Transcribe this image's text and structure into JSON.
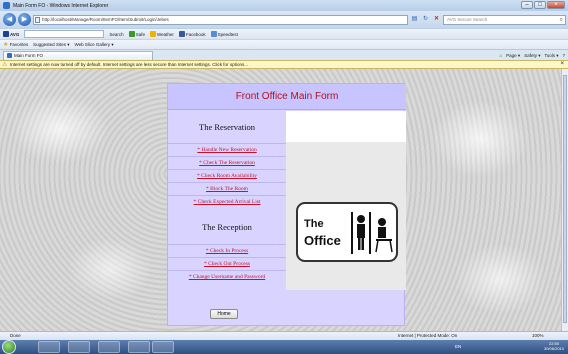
{
  "window": {
    "title": "Main Form FO - Windows Internet Explorer"
  },
  "nav": {
    "url": "http://localhost/Manage/Room/ItemFO/Item/Submit/Login/Jebes",
    "search_placeholder": "AVG Secure Search"
  },
  "toolbar": {
    "avg_label": "AVG",
    "search_label": "Search",
    "safe_label": "Safe",
    "weather_label": "Weather",
    "facebook_label": "Facebook",
    "speedtest_label": "Speedtest"
  },
  "favorites": {
    "favorites_label": "Favorites",
    "suggested_label": "Suggested Sites ▾",
    "slice_label": "Web Slice Gallery ▾"
  },
  "tab": {
    "label": "Main Form FO"
  },
  "commands": [
    "Page ▾",
    "Safety ▾",
    "Tools ▾"
  ],
  "infobar": {
    "text": "Internet settings are now turned off by default. Internet settings are less secure than Internet settings. Click for options..."
  },
  "form": {
    "title": "Front Office Main Form",
    "reservation_heading": "The Reservation",
    "reservation_links": [
      "* Handle New Reservation",
      "* Check The Reservation",
      "* Check Room Availability",
      "* Block The Room",
      "* Check Expected Arrival List"
    ],
    "reception_heading": "The Reception",
    "reception_links": [
      "* Check In Process",
      "* Check Out Process",
      "* Change Username and Password"
    ],
    "home_button": "Home",
    "logo_line1": "The",
    "logo_line2": "Office"
  },
  "status": {
    "left": "Done",
    "zone": "Internet | Protected Mode: On",
    "zoom": "100%"
  },
  "taskbar": {
    "lang": "EN",
    "time": "22:50",
    "date": "30/06/2010"
  }
}
